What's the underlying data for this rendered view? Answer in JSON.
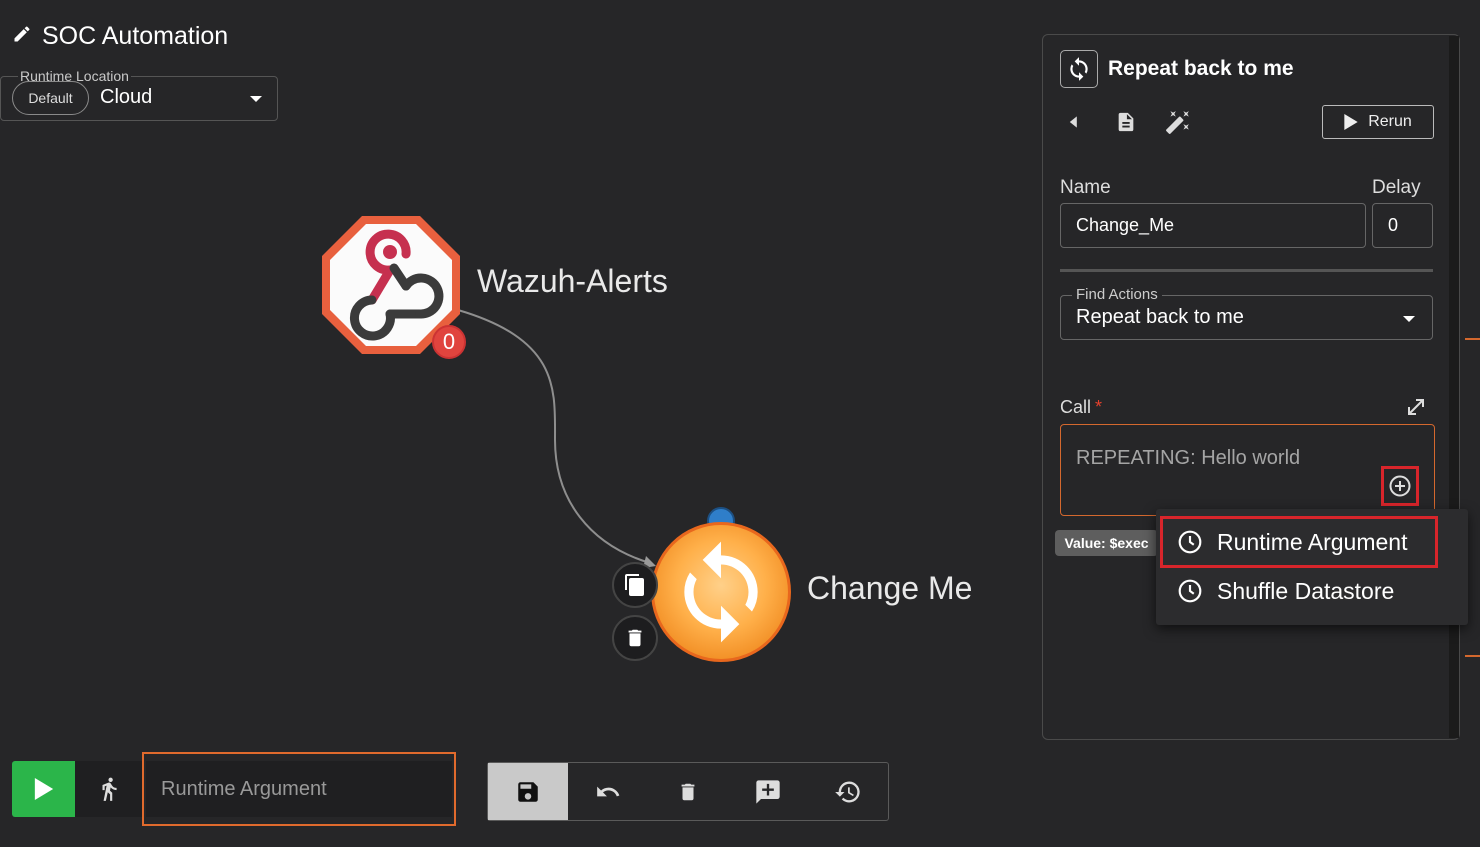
{
  "app": {
    "title": "SOC Automation"
  },
  "runtime": {
    "legend": "Runtime Location",
    "default_pill": "Default",
    "value": "Cloud"
  },
  "graph": {
    "nodes": [
      {
        "label": "Wazuh-Alerts",
        "icon": "webhook-icon",
        "badge": "0"
      },
      {
        "label": "Change Me",
        "icon": "repeat-icon"
      }
    ]
  },
  "panel": {
    "title": "Repeat back to me",
    "rerun_label": "Rerun",
    "name_label": "Name",
    "name_value": "Change_Me",
    "delay_label": "Delay",
    "delay_value": "0",
    "find_actions_label": "Find Actions",
    "find_actions_value": "Repeat back to me",
    "call_label": "Call",
    "call_required": "*",
    "call_value": "REPEATING: Hello world",
    "tooltip": "Value: $exec",
    "menu": [
      {
        "label": "Runtime Argument",
        "icon": "clock-icon"
      },
      {
        "label": "Shuffle Datastore",
        "icon": "clock-icon"
      }
    ]
  },
  "bottom": {
    "argument_placeholder": "Runtime Argument"
  },
  "colors": {
    "accent_orange": "#e06a2d",
    "highlight_red": "#d8252b",
    "play_green": "#2bb54a"
  }
}
